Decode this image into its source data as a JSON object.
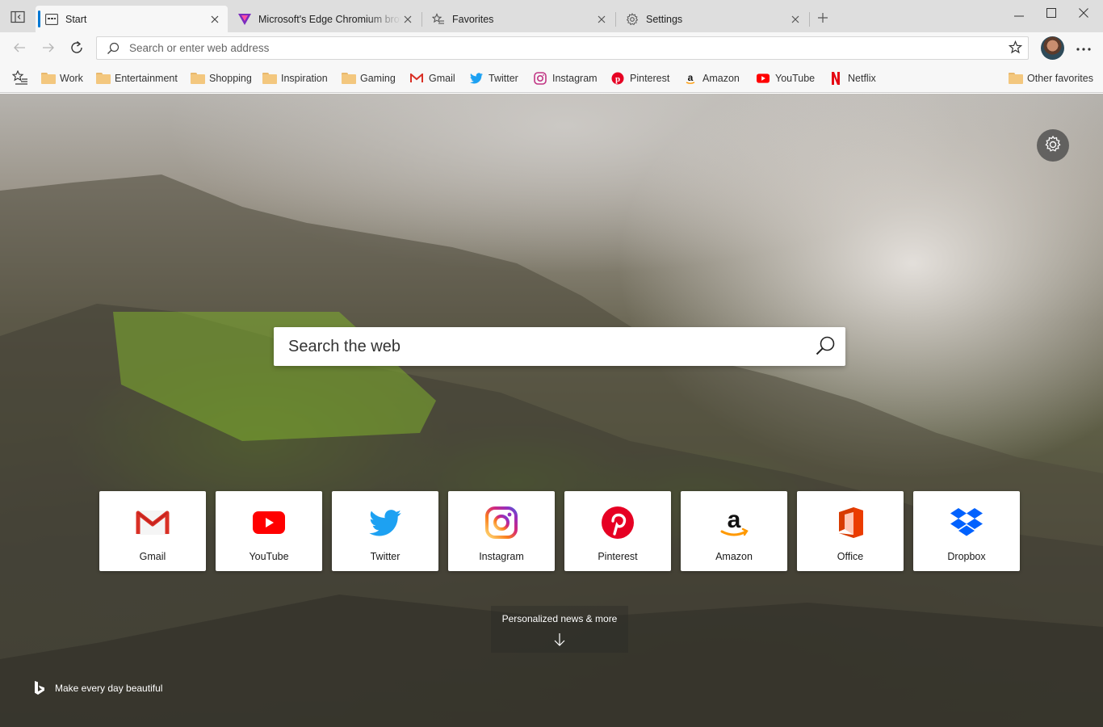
{
  "tabs": [
    {
      "title": "Start",
      "active": true,
      "icon": "new-tab-icon"
    },
    {
      "title": "Microsoft's Edge Chromium browser",
      "active": false,
      "icon": "site-logo-icon"
    },
    {
      "title": "Favorites",
      "active": false,
      "icon": "favorites-star-icon"
    },
    {
      "title": "Settings",
      "active": false,
      "icon": "gear-icon"
    }
  ],
  "address_bar": {
    "placeholder": "Search or enter web address",
    "value": ""
  },
  "favorites_bar": {
    "items": [
      {
        "label": "Work",
        "icon": "folder-icon"
      },
      {
        "label": "Entertainment",
        "icon": "folder-icon"
      },
      {
        "label": "Shopping",
        "icon": "folder-icon"
      },
      {
        "label": "Inspiration",
        "icon": "folder-icon"
      },
      {
        "label": "Gaming",
        "icon": "folder-icon"
      },
      {
        "label": "Gmail",
        "icon": "gmail-icon"
      },
      {
        "label": "Twitter",
        "icon": "twitter-icon"
      },
      {
        "label": "Instagram",
        "icon": "instagram-icon"
      },
      {
        "label": "Pinterest",
        "icon": "pinterest-icon"
      },
      {
        "label": "Amazon",
        "icon": "amazon-icon"
      },
      {
        "label": "YouTube",
        "icon": "youtube-icon"
      },
      {
        "label": "Netflix",
        "icon": "netflix-icon"
      }
    ],
    "other_favorites": "Other favorites"
  },
  "search": {
    "placeholder": "Search the web"
  },
  "quick_links": [
    {
      "label": "Gmail",
      "icon": "gmail-icon"
    },
    {
      "label": "YouTube",
      "icon": "youtube-icon"
    },
    {
      "label": "Twitter",
      "icon": "twitter-icon"
    },
    {
      "label": "Instagram",
      "icon": "instagram-icon"
    },
    {
      "label": "Pinterest",
      "icon": "pinterest-icon"
    },
    {
      "label": "Amazon",
      "icon": "amazon-icon"
    },
    {
      "label": "Office",
      "icon": "office-icon"
    },
    {
      "label": "Dropbox",
      "icon": "dropbox-icon"
    }
  ],
  "news": {
    "label": "Personalized news & more"
  },
  "footer": {
    "tagline": "Make every day beautiful"
  },
  "colors": {
    "accent": "#0078d4",
    "gmail_red": "#d93025",
    "youtube_red": "#ff0000",
    "twitter_blue": "#1da1f2",
    "pinterest_red": "#e60023",
    "dropbox_blue": "#0061fe",
    "office_orange": "#d83b01",
    "netflix_red": "#e50914"
  }
}
